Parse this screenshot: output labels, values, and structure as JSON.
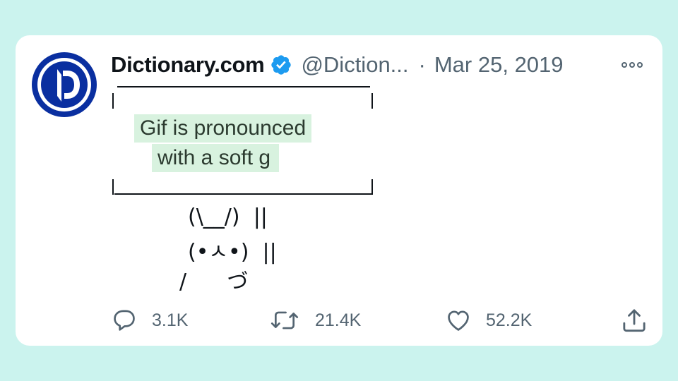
{
  "tweet": {
    "display_name": "Dictionary.com",
    "handle": "@Diction...",
    "separator": "·",
    "date": "Mar 25, 2019",
    "verified": true,
    "avatar_icon": "dictionary-logo-icon",
    "brand_color": "#0a2fa0",
    "verified_color": "#1d9bf0",
    "highlight_color": "#d8f2df",
    "sign_text_line1": "Gif is pronounced",
    "sign_text_line2": "with a soft g",
    "bunny_line1": "(\\__/)  ||",
    "bunny_line2": "(•ㅅ•)  ||",
    "bunny_line3": "/      づ"
  },
  "actions": {
    "replies": "3.1K",
    "retweets": "21.4K",
    "likes": "52.2K",
    "reply_icon": "reply-icon",
    "retweet_icon": "retweet-icon",
    "like_icon": "heart-icon",
    "share_icon": "share-icon"
  },
  "background_color": "#cbf3ee"
}
